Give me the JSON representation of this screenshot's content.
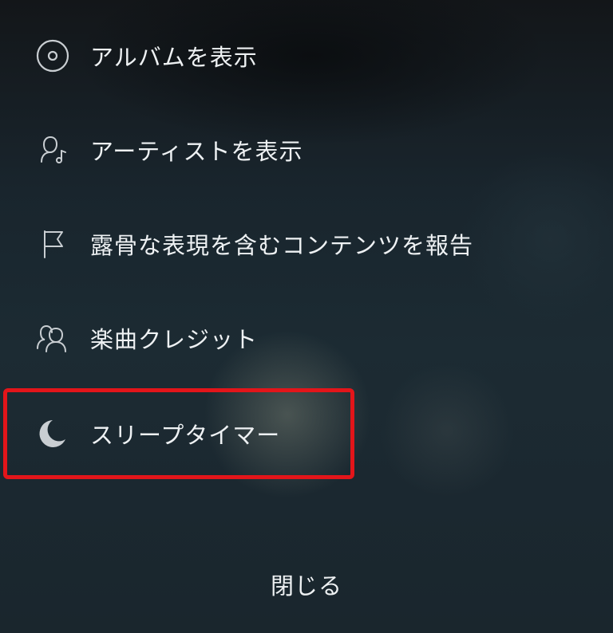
{
  "menu": {
    "items": [
      {
        "label": "アルバムを表示",
        "icon": "album-icon"
      },
      {
        "label": "アーティストを表示",
        "icon": "artist-icon"
      },
      {
        "label": "露骨な表現を含むコンテンツを報告",
        "icon": "flag-icon"
      },
      {
        "label": "楽曲クレジット",
        "icon": "credits-icon"
      },
      {
        "label": "スリープタイマー",
        "icon": "moon-icon"
      }
    ],
    "close_label": "閉じる"
  },
  "colors": {
    "highlight_border": "#e3151a",
    "text": "#eef1f3",
    "icon_stroke": "#c9ced2"
  }
}
